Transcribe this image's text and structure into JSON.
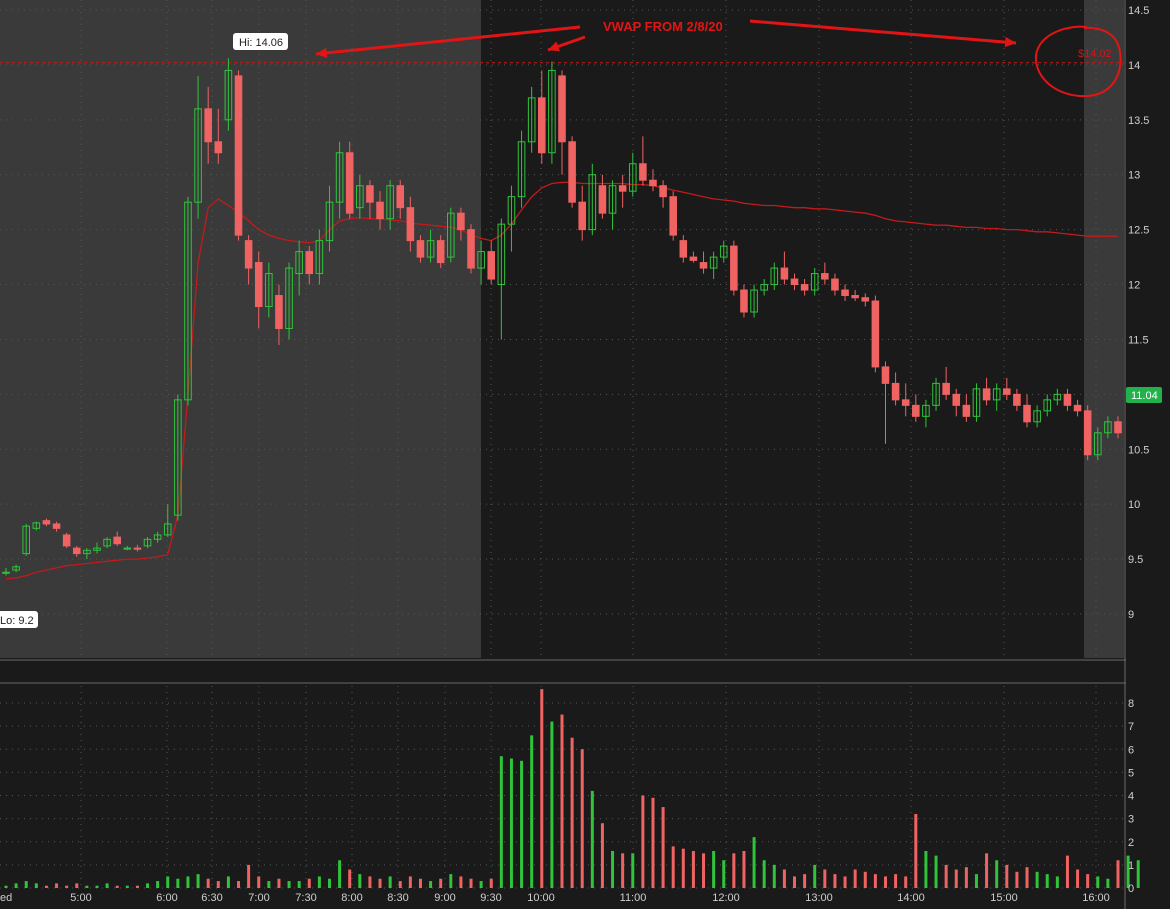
{
  "colors": {
    "background": "#1a1a1a",
    "premarket_shade": "#3a3a3a",
    "postmarket_shade": "#3a3a3a",
    "up": "#2fc43a",
    "down": "#f06363",
    "vwap": "#c41a1a",
    "grid": "#555555",
    "annotation": "#e11515",
    "price_tag": "#22b14c"
  },
  "labels": {
    "hi": "Hi: 14.06",
    "lo": "Lo: 9.2",
    "annotation": "VWAP FROM 2/8/20",
    "ref_price": "$14.02",
    "last_price": "11.04",
    "left_edge": "ed"
  },
  "chart_data": [
    {
      "type": "candlestick",
      "title": "",
      "ylim": [
        8.75,
        14.6
      ],
      "yticks": [
        "14.5",
        "14",
        "13.5",
        "13",
        "12.5",
        "12",
        "11.5",
        "11",
        "10.5",
        "10",
        "9.5",
        "9"
      ],
      "xticks": [
        "5:00",
        "6:00",
        "6:30",
        "7:00",
        "7:30",
        "8:00",
        "8:30",
        "9:00",
        "9:30",
        "10:00",
        "11:00",
        "12:00",
        "13:00",
        "14:00",
        "15:00",
        "16:00"
      ],
      "sessions": {
        "premarket_end": "9:30",
        "regular_end": "16:00"
      },
      "hi": 14.06,
      "lo": 9.2,
      "last": 11.04,
      "vwap_reference": 14.02,
      "candles_ohlc": [
        [
          9.38,
          9.42,
          9.35,
          9.38
        ],
        [
          9.4,
          9.45,
          9.38,
          9.43
        ],
        [
          9.55,
          9.82,
          9.53,
          9.8
        ],
        [
          9.78,
          9.84,
          9.76,
          9.83
        ],
        [
          9.85,
          9.87,
          9.8,
          9.82
        ],
        [
          9.82,
          9.84,
          9.75,
          9.78
        ],
        [
          9.72,
          9.74,
          9.6,
          9.62
        ],
        [
          9.6,
          9.62,
          9.52,
          9.55
        ],
        [
          9.55,
          9.6,
          9.5,
          9.58
        ],
        [
          9.58,
          9.65,
          9.55,
          9.6
        ],
        [
          9.62,
          9.7,
          9.6,
          9.68
        ],
        [
          9.7,
          9.75,
          9.62,
          9.64
        ],
        [
          9.6,
          9.62,
          9.58,
          9.6
        ],
        [
          9.6,
          9.63,
          9.57,
          9.59
        ],
        [
          9.62,
          9.7,
          9.6,
          9.68
        ],
        [
          9.68,
          9.75,
          9.65,
          9.72
        ],
        [
          9.72,
          10.0,
          9.7,
          9.82
        ],
        [
          9.9,
          11.0,
          9.85,
          10.95
        ],
        [
          10.95,
          12.8,
          10.9,
          12.75
        ],
        [
          12.75,
          13.9,
          12.6,
          13.6
        ],
        [
          13.6,
          13.8,
          13.1,
          13.3
        ],
        [
          13.3,
          13.6,
          13.1,
          13.2
        ],
        [
          13.5,
          14.06,
          13.4,
          13.95
        ],
        [
          13.9,
          13.95,
          12.4,
          12.45
        ],
        [
          12.4,
          12.45,
          12.0,
          12.15
        ],
        [
          12.2,
          12.3,
          11.6,
          11.8
        ],
        [
          11.8,
          12.2,
          11.7,
          12.1
        ],
        [
          11.9,
          12.0,
          11.45,
          11.6
        ],
        [
          11.6,
          12.2,
          11.5,
          12.15
        ],
        [
          12.1,
          12.4,
          11.9,
          12.3
        ],
        [
          12.3,
          12.35,
          12.0,
          12.1
        ],
        [
          12.1,
          12.5,
          12.0,
          12.4
        ],
        [
          12.4,
          12.9,
          12.3,
          12.75
        ],
        [
          12.75,
          13.3,
          12.6,
          13.2
        ],
        [
          13.2,
          13.3,
          12.6,
          12.65
        ],
        [
          12.7,
          13.0,
          12.6,
          12.9
        ],
        [
          12.9,
          12.95,
          12.6,
          12.75
        ],
        [
          12.75,
          12.85,
          12.5,
          12.6
        ],
        [
          12.6,
          12.95,
          12.5,
          12.9
        ],
        [
          12.9,
          12.95,
          12.6,
          12.7
        ],
        [
          12.7,
          12.8,
          12.3,
          12.4
        ],
        [
          12.4,
          12.45,
          12.2,
          12.25
        ],
        [
          12.25,
          12.5,
          12.2,
          12.4
        ],
        [
          12.4,
          12.45,
          12.15,
          12.2
        ],
        [
          12.25,
          12.7,
          12.2,
          12.65
        ],
        [
          12.65,
          12.7,
          12.4,
          12.5
        ],
        [
          12.5,
          12.55,
          12.1,
          12.15
        ],
        [
          12.15,
          12.4,
          12.0,
          12.3
        ],
        [
          12.3,
          12.4,
          12.0,
          12.05
        ],
        [
          12.0,
          12.6,
          11.5,
          12.55
        ],
        [
          12.55,
          12.9,
          12.3,
          12.8
        ],
        [
          12.8,
          13.4,
          12.7,
          13.3
        ],
        [
          13.3,
          13.8,
          13.2,
          13.7
        ],
        [
          13.7,
          13.95,
          13.1,
          13.2
        ],
        [
          13.2,
          14.03,
          13.1,
          13.95
        ],
        [
          13.9,
          13.95,
          13.0,
          13.3
        ],
        [
          13.3,
          13.35,
          12.7,
          12.75
        ],
        [
          12.75,
          12.9,
          12.4,
          12.5
        ],
        [
          12.5,
          13.1,
          12.45,
          13.0
        ],
        [
          12.9,
          13.0,
          12.6,
          12.65
        ],
        [
          12.65,
          12.95,
          12.5,
          12.9
        ],
        [
          12.9,
          13.0,
          12.7,
          12.85
        ],
        [
          12.85,
          13.2,
          12.8,
          13.1
        ],
        [
          13.1,
          13.35,
          12.9,
          12.95
        ],
        [
          12.95,
          13.05,
          12.85,
          12.9
        ],
        [
          12.9,
          12.95,
          12.7,
          12.8
        ],
        [
          12.8,
          12.85,
          12.4,
          12.45
        ],
        [
          12.4,
          12.45,
          12.2,
          12.25
        ],
        [
          12.25,
          12.3,
          12.2,
          12.22
        ],
        [
          12.2,
          12.3,
          12.1,
          12.15
        ],
        [
          12.15,
          12.3,
          12.05,
          12.25
        ],
        [
          12.25,
          12.4,
          12.2,
          12.35
        ],
        [
          12.35,
          12.4,
          11.9,
          11.95
        ],
        [
          11.95,
          12.0,
          11.7,
          11.75
        ],
        [
          11.75,
          12.0,
          11.7,
          11.95
        ],
        [
          11.95,
          12.05,
          11.9,
          12.0
        ],
        [
          12.0,
          12.2,
          11.95,
          12.15
        ],
        [
          12.15,
          12.3,
          12.0,
          12.05
        ],
        [
          12.05,
          12.1,
          11.95,
          12.0
        ],
        [
          12.0,
          12.05,
          11.9,
          11.95
        ],
        [
          11.95,
          12.15,
          11.9,
          12.1
        ],
        [
          12.1,
          12.2,
          12.0,
          12.05
        ],
        [
          12.05,
          12.1,
          11.9,
          11.95
        ],
        [
          11.95,
          12.0,
          11.85,
          11.9
        ],
        [
          11.9,
          11.95,
          11.85,
          11.88
        ],
        [
          11.88,
          11.92,
          11.8,
          11.85
        ],
        [
          11.85,
          11.9,
          11.2,
          11.25
        ],
        [
          11.25,
          11.3,
          10.55,
          11.1
        ],
        [
          11.1,
          11.2,
          10.9,
          10.95
        ],
        [
          10.95,
          11.1,
          10.8,
          10.9
        ],
        [
          10.9,
          11.0,
          10.75,
          10.8
        ],
        [
          10.8,
          10.95,
          10.7,
          10.9
        ],
        [
          10.9,
          11.15,
          10.85,
          11.1
        ],
        [
          11.1,
          11.25,
          10.95,
          11.0
        ],
        [
          11.0,
          11.05,
          10.8,
          10.9
        ],
        [
          10.9,
          11.0,
          10.75,
          10.8
        ],
        [
          10.8,
          11.1,
          10.75,
          11.05
        ],
        [
          11.05,
          11.15,
          10.9,
          10.95
        ],
        [
          10.95,
          11.1,
          10.85,
          11.05
        ],
        [
          11.05,
          11.15,
          10.95,
          11.0
        ],
        [
          11.0,
          11.05,
          10.85,
          10.9
        ],
        [
          10.9,
          11.0,
          10.7,
          10.75
        ],
        [
          10.75,
          10.9,
          10.7,
          10.85
        ],
        [
          10.85,
          11.0,
          10.8,
          10.95
        ],
        [
          10.95,
          11.05,
          10.9,
          11.0
        ],
        [
          11.0,
          11.05,
          10.85,
          10.9
        ],
        [
          10.9,
          10.95,
          10.8,
          10.85
        ],
        [
          10.85,
          10.9,
          10.4,
          10.45
        ],
        [
          10.45,
          10.7,
          10.4,
          10.65
        ],
        [
          10.65,
          10.8,
          10.6,
          10.75
        ],
        [
          10.75,
          10.8,
          10.6,
          10.65
        ]
      ],
      "vwap_series": [
        9.32,
        9.33,
        9.35,
        9.38,
        9.4,
        9.42,
        9.44,
        9.45,
        9.46,
        9.47,
        9.48,
        9.49,
        9.5,
        9.5,
        9.51,
        9.52,
        9.54,
        9.9,
        11.0,
        12.2,
        12.7,
        12.78,
        12.72,
        12.66,
        12.58,
        12.5,
        12.45,
        12.42,
        12.4,
        12.39,
        12.38,
        12.4,
        12.5,
        12.58,
        12.6,
        12.61,
        12.6,
        12.6,
        12.59,
        12.58,
        12.56,
        12.55,
        12.54,
        12.53,
        12.52,
        12.5,
        12.45,
        12.42,
        12.4,
        12.45,
        12.55,
        12.68,
        12.8,
        12.88,
        12.92,
        12.93,
        12.93,
        12.92,
        12.92,
        12.92,
        12.92,
        12.92,
        12.91,
        12.91,
        12.9,
        12.88,
        12.86,
        12.84,
        12.82,
        12.8,
        12.78,
        12.77,
        12.76,
        12.74,
        12.73,
        12.72,
        12.72,
        12.71,
        12.7,
        12.7,
        12.69,
        12.69,
        12.68,
        12.67,
        12.66,
        12.65,
        12.63,
        12.6,
        12.58,
        12.57,
        12.56,
        12.55,
        12.54,
        12.54,
        12.53,
        12.52,
        12.52,
        12.51,
        12.51,
        12.5,
        12.5,
        12.49,
        12.48,
        12.48,
        12.47,
        12.46,
        12.45,
        12.44,
        12.44,
        12.44,
        12.44
      ],
      "volume_ylim": [
        0,
        9
      ],
      "volume_yticks": [
        "8",
        "7",
        "6",
        "5",
        "4",
        "3",
        "2",
        "1",
        "0"
      ],
      "volume": [
        0.1,
        0.2,
        0.3,
        0.2,
        0.1,
        0.2,
        0.1,
        0.2,
        0.1,
        0.1,
        0.2,
        0.1,
        0.1,
        0.1,
        0.2,
        0.3,
        0.5,
        0.4,
        0.5,
        0.6,
        0.4,
        0.3,
        0.5,
        0.3,
        1.0,
        0.5,
        0.3,
        0.4,
        0.3,
        0.3,
        0.4,
        0.5,
        0.4,
        1.2,
        0.8,
        0.6,
        0.5,
        0.4,
        0.5,
        0.3,
        0.5,
        0.4,
        0.3,
        0.4,
        0.6,
        0.5,
        0.4,
        0.3,
        0.4,
        5.7,
        5.6,
        5.5,
        6.6,
        8.6,
        7.2,
        7.5,
        6.5,
        6.0,
        4.2,
        2.8,
        1.6,
        1.5,
        1.5,
        4.0,
        3.9,
        3.5,
        1.8,
        1.7,
        1.6,
        1.5,
        1.6,
        1.2,
        1.5,
        1.6,
        2.2,
        1.2,
        1.0,
        0.8,
        0.5,
        0.6,
        1.0,
        0.8,
        0.6,
        0.5,
        0.8,
        0.7,
        0.6,
        0.5,
        0.6,
        0.5,
        3.2,
        1.6,
        1.4,
        1.0,
        0.8,
        0.9,
        0.6,
        1.5,
        1.2,
        1.0,
        0.7,
        0.9,
        0.7,
        0.6,
        0.5,
        1.4,
        0.8,
        0.6,
        0.5,
        0.4,
        1.2,
        1.4,
        1.2
      ]
    }
  ]
}
